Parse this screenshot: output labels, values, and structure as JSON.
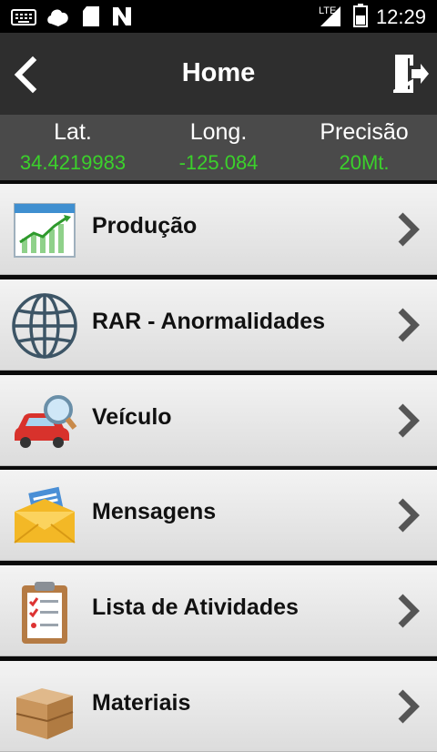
{
  "status": {
    "time": "12:29",
    "network": "LTE",
    "icons": [
      "keyboard-icon",
      "cloud-icon",
      "sd-card-icon",
      "n-icon",
      "signal-icon",
      "battery-icon"
    ]
  },
  "header": {
    "title": "Home",
    "back_icon": "chevron-left-icon",
    "logout_icon": "logout-icon"
  },
  "gps": {
    "lat_label": "Lat.",
    "lat_value": "34.4219983",
    "long_label": "Long.",
    "long_value": "-125.084",
    "prec_label": "Precisão",
    "prec_value": "20Mt."
  },
  "menu": {
    "items": [
      {
        "label": "Produção",
        "icon": "production-chart-icon"
      },
      {
        "label": "RAR - Anormalidades",
        "icon": "globe-icon"
      },
      {
        "label": "Veículo",
        "icon": "car-search-icon"
      },
      {
        "label": "Mensagens",
        "icon": "envelope-icon"
      },
      {
        "label": "Lista de Atividades",
        "icon": "clipboard-checklist-icon"
      },
      {
        "label": "Materiais",
        "icon": "crate-icon"
      }
    ]
  },
  "colors": {
    "header_bg": "#2e2e2e",
    "gps_bg": "#4a4a4a",
    "gps_value": "#3bd12b",
    "item_bg_top": "#f3f3f3",
    "item_bg_bottom": "#dcdcdc"
  }
}
